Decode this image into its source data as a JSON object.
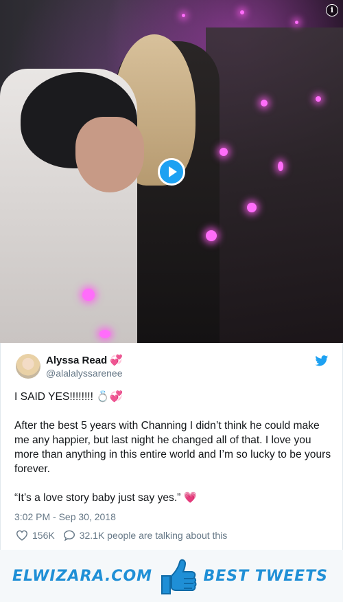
{
  "tweet": {
    "name": "Alyssa Read",
    "name_emoji": "💞",
    "handle": "@alalalyssarenee",
    "line1": "I SAID YES!!!!!!!! 💍💞",
    "line2": "After the best 5 years with Channing I didn’t think he could make me any happier, but last night he changed all of that. I love you more than anything in this entire world and I’m so lucky to be yours forever.",
    "line3": "“It’s a love story baby just say yes.” 💗",
    "timestamp": "3:02 PM - Sep 30, 2018",
    "likes": "156K",
    "replies": "32.1K people are talking about this"
  },
  "footer": {
    "site": "ELWIZARA.COM",
    "tagline": "BEST TWEETS"
  },
  "colors": {
    "twitter_blue": "#1da1f2",
    "brand_blue": "#1f8fd6"
  }
}
